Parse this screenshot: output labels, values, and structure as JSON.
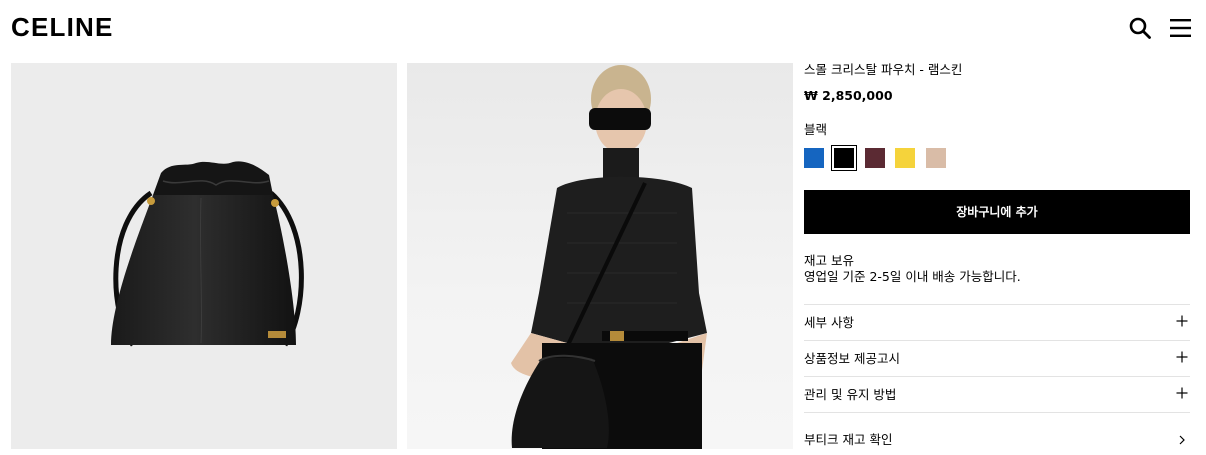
{
  "header": {
    "logo": "CELINE",
    "search_icon": "search-icon",
    "menu_icon": "hamburger-menu-icon"
  },
  "images": [
    {
      "name": "product-image-bag"
    },
    {
      "name": "product-image-model"
    }
  ],
  "product": {
    "title": "스몰 크리스탈 파우치 - 램스킨",
    "price": "₩ 2,850,000",
    "color_label": "블랙",
    "swatches": [
      {
        "color": "#1565c0",
        "selected": false
      },
      {
        "color": "#000000",
        "selected": true
      },
      {
        "color": "#5b2a33",
        "selected": false
      },
      {
        "color": "#f5d33b",
        "selected": false
      },
      {
        "color": "#d9bca7",
        "selected": false
      }
    ],
    "add_to_cart": "장바구니에 추가",
    "stock": "재고 보유",
    "shipping": "영업일 기준 2-5일 이내 배송 가능합니다."
  },
  "accordion": [
    {
      "label": "세부 사항",
      "icon": "plus-icon"
    },
    {
      "label": "상품정보 제공고시",
      "icon": "plus-icon"
    },
    {
      "label": "관리 및 유지 방법",
      "icon": "plus-icon"
    },
    {
      "label": "부티크 재고 확인",
      "icon": "chevron-right-icon"
    }
  ]
}
